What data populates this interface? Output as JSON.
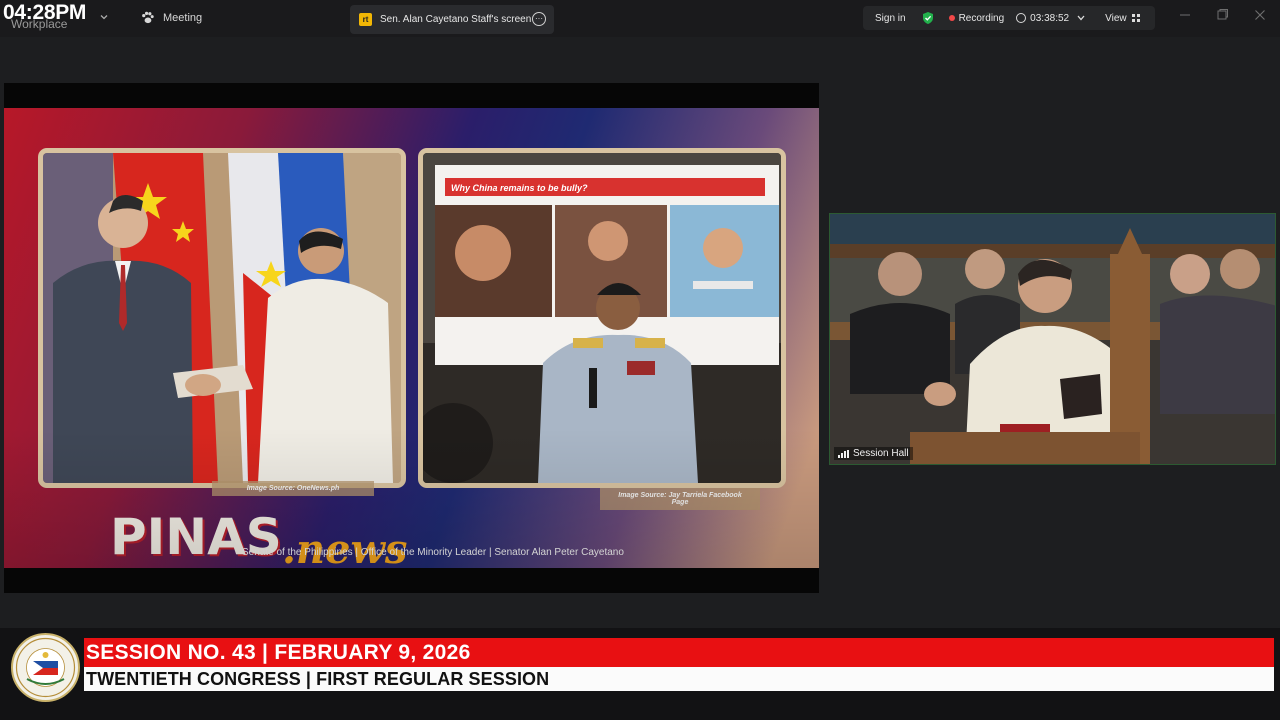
{
  "topbar": {
    "clock": "04:28PM",
    "workplace_label": "Workplace",
    "meeting_label": "Meeting",
    "share_logo": "rt",
    "share_tab_label": "Sen. Alan Cayetano Staff's screen",
    "sign_in": "Sign in",
    "recording_label": "Recording",
    "timer": "03:38:52",
    "view_label": "View"
  },
  "slide": {
    "left_source": "Image Source: OneNews.ph",
    "right_source": "Image Source: Jay Tarriela Facebook Page",
    "inner_slide_title": "Why China remains to be bully?",
    "brand_main": "PINAS",
    "brand_news": ".news",
    "ticker": "Senate of the Philippines | Office of the Minority Leader | Senator Alan Peter Cayetano"
  },
  "camera": {
    "label": "Session Hall"
  },
  "lower_third": {
    "session_line": "SESSION NO. 43 | FEBRUARY 9, 2026",
    "congress_line": "TWENTIETH CONGRESS | FIRST REGULAR SESSION",
    "seal_lettering": "SENATE OF THE PHILIPPINES · OFFICIAL SEAL"
  },
  "colors": {
    "accent_red": "#e81012",
    "recording_dot": "#f24848",
    "shield_green": "#22b14c"
  }
}
